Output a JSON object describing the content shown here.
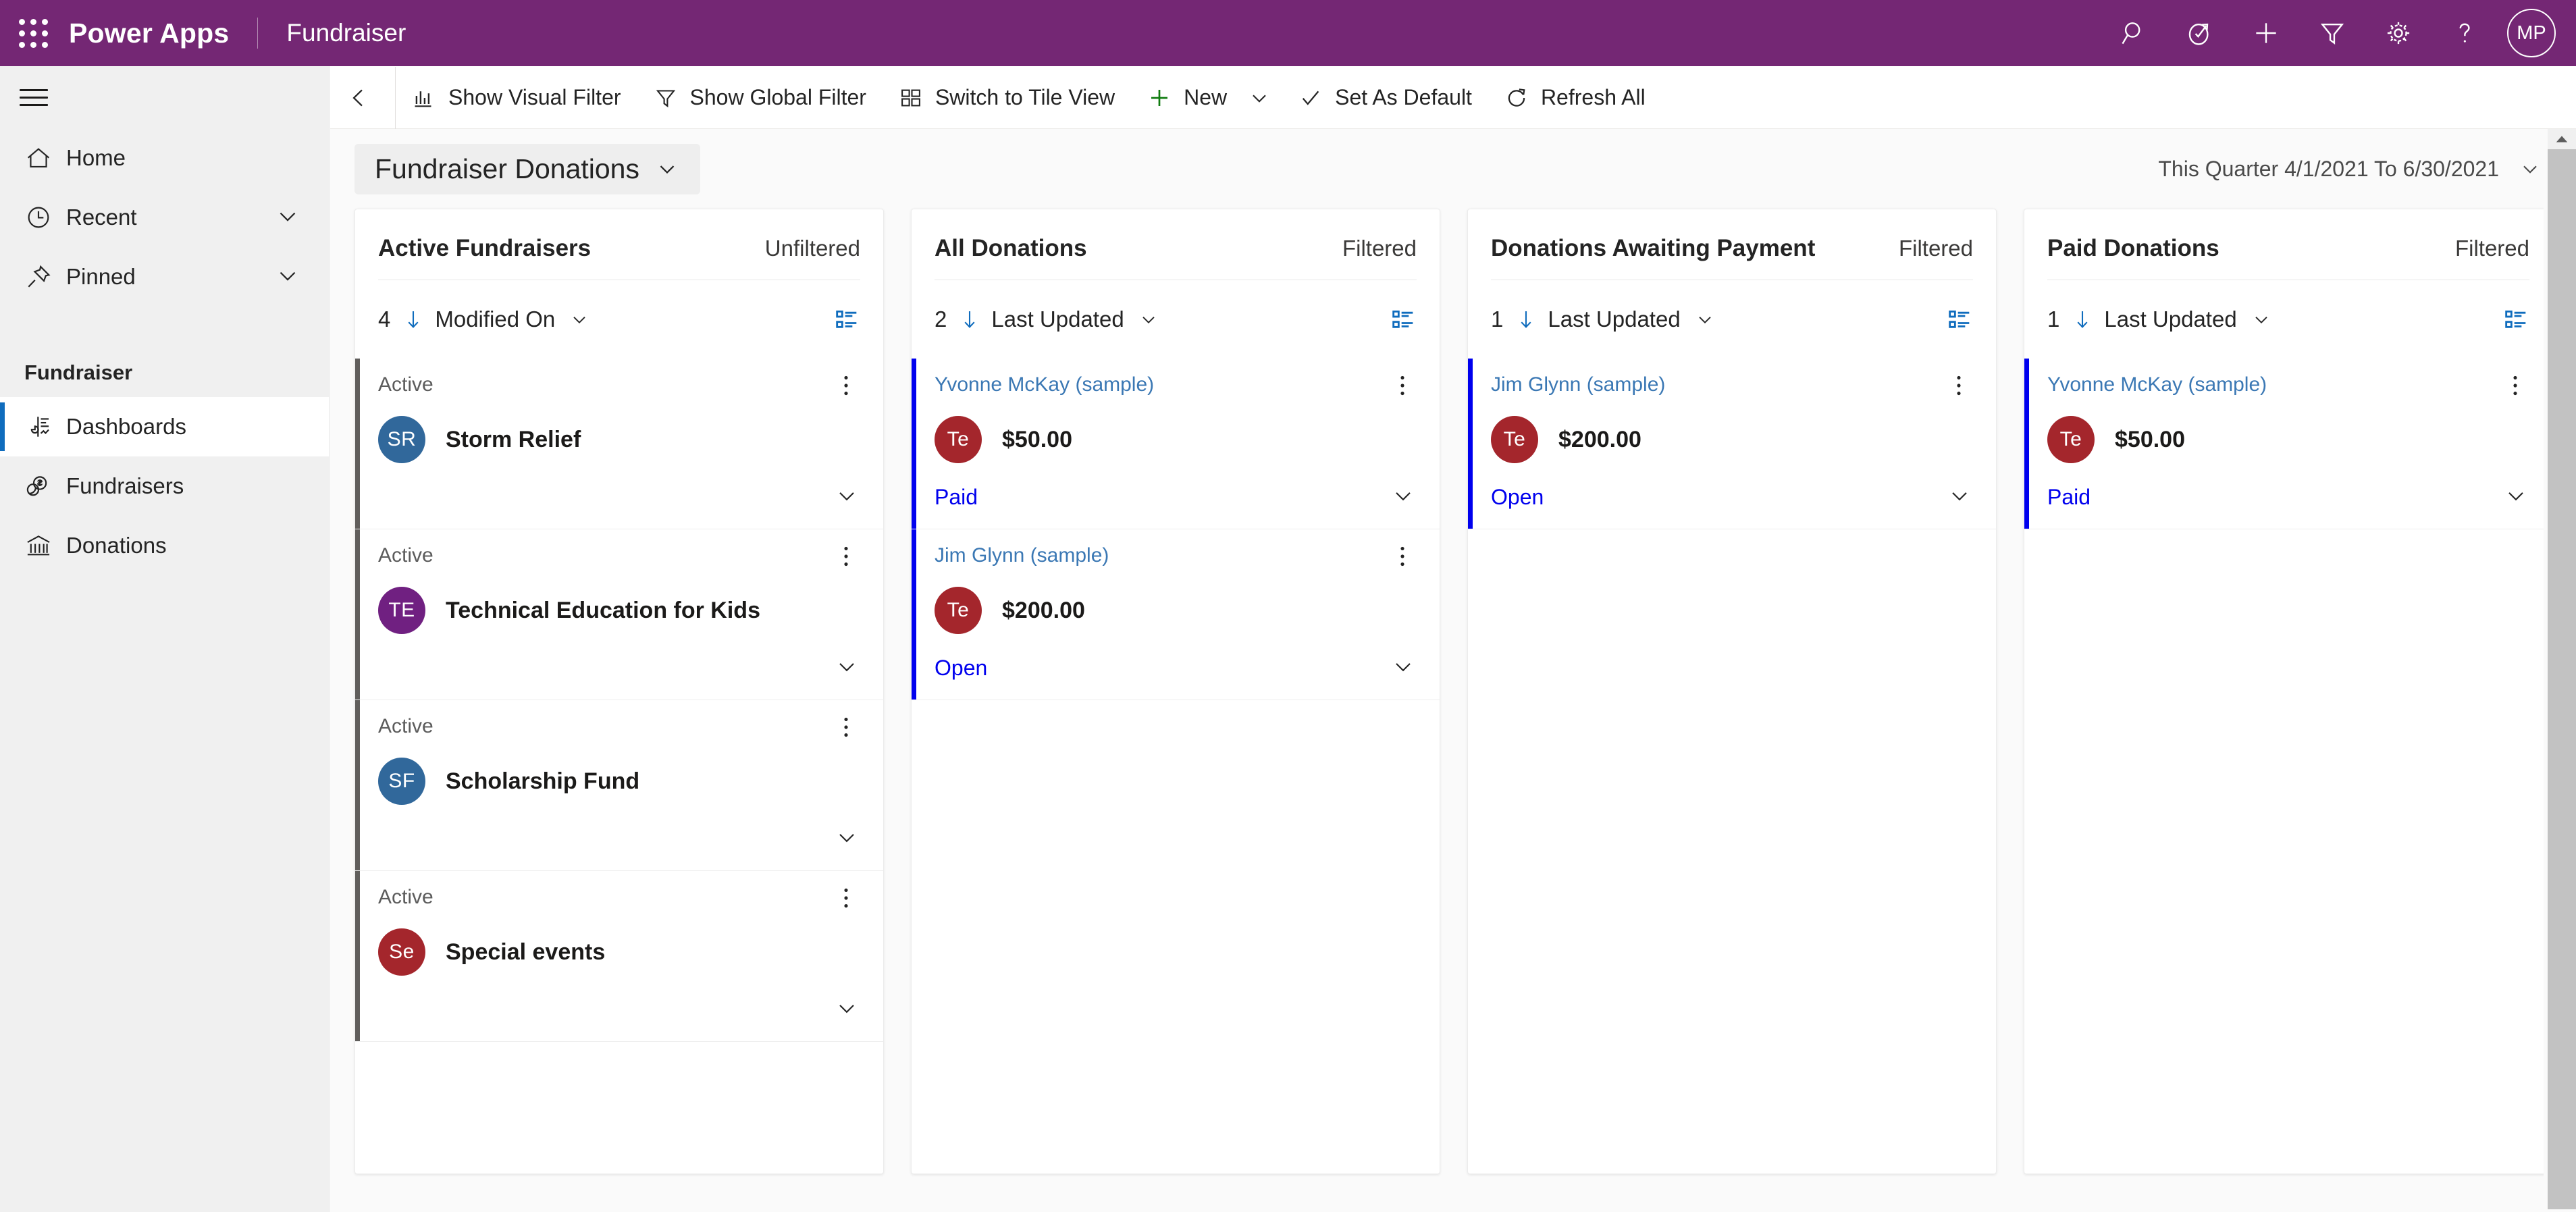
{
  "header": {
    "waffle_icon": "app-launcher-icon",
    "brand": "Power Apps",
    "app_name": "Fundraiser",
    "icons": [
      "search-icon",
      "assistant-icon",
      "new-icon",
      "filter-icon",
      "settings-icon",
      "help-icon"
    ],
    "avatar_initials": "MP",
    "bg_color": "#742774"
  },
  "sidebar": {
    "hamburger_icon": "hamburger-icon",
    "items": [
      {
        "label": "Home",
        "icon": "home-icon",
        "expandable": false,
        "selected": false
      },
      {
        "label": "Recent",
        "icon": "clock-icon",
        "expandable": true,
        "selected": false
      },
      {
        "label": "Pinned",
        "icon": "pin-icon",
        "expandable": true,
        "selected": false
      }
    ],
    "group_title": "Fundraiser",
    "group_items": [
      {
        "label": "Dashboards",
        "icon": "dashboard-icon",
        "selected": true
      },
      {
        "label": "Fundraisers",
        "icon": "coins-icon",
        "selected": false
      },
      {
        "label": "Donations",
        "icon": "bank-icon",
        "selected": false
      }
    ],
    "accent_color": "#0f6cbd"
  },
  "commandbar": {
    "back_icon": "back-arrow-icon",
    "buttons": [
      {
        "label": "Show Visual Filter",
        "icon": "bar-chart-icon",
        "caret": false
      },
      {
        "label": "Show Global Filter",
        "icon": "funnel-icon",
        "caret": false
      },
      {
        "label": "Switch to Tile View",
        "icon": "tile-view-icon",
        "caret": false
      },
      {
        "label": "New",
        "icon": "plus-icon",
        "caret": true
      },
      {
        "label": "Set As Default",
        "icon": "checkmark-icon",
        "caret": false
      },
      {
        "label": "Refresh All",
        "icon": "refresh-icon",
        "caret": false
      }
    ],
    "new_icon_color": "#107c10"
  },
  "dashboard": {
    "title": "Fundraiser Donations",
    "title_chevron": "chevron-down-icon",
    "date_range": "This Quarter 4/1/2021 To 6/30/2021",
    "date_range_chevron": "chevron-down-icon"
  },
  "columns": [
    {
      "title": "Active Fundraisers",
      "filter_state": "Unfiltered",
      "count": "4",
      "sort_field": "Modified On",
      "view_icon": "list-view-icon",
      "bar": "gray",
      "cards": [
        {
          "status": "Active",
          "status_is_link": false,
          "avatar": "SR",
          "avatar_color": "#31689b",
          "main": "Storm Relief",
          "state": ""
        },
        {
          "status": "Active",
          "status_is_link": false,
          "avatar": "TE",
          "avatar_color": "#702081",
          "main": "Technical Education for Kids",
          "state": ""
        },
        {
          "status": "Active",
          "status_is_link": false,
          "avatar": "SF",
          "avatar_color": "#31689b",
          "main": "Scholarship Fund",
          "state": ""
        },
        {
          "status": "Active",
          "status_is_link": false,
          "avatar": "Se",
          "avatar_color": "#a4262c",
          "main": "Special events",
          "state": ""
        }
      ]
    },
    {
      "title": "All Donations",
      "filter_state": "Filtered",
      "count": "2",
      "sort_field": "Last Updated",
      "view_icon": "list-view-icon",
      "bar": "blue",
      "cards": [
        {
          "status": "Yvonne McKay (sample)",
          "status_is_link": true,
          "avatar": "Te",
          "avatar_color": "#a4262c",
          "main": "$50.00",
          "state": "Paid"
        },
        {
          "status": "Jim Glynn (sample)",
          "status_is_link": true,
          "avatar": "Te",
          "avatar_color": "#a4262c",
          "main": "$200.00",
          "state": "Open"
        }
      ]
    },
    {
      "title": "Donations Awaiting Payment",
      "filter_state": "Filtered",
      "count": "1",
      "sort_field": "Last Updated",
      "view_icon": "list-view-icon",
      "bar": "blue",
      "cards": [
        {
          "status": "Jim Glynn (sample)",
          "status_is_link": true,
          "avatar": "Te",
          "avatar_color": "#a4262c",
          "main": "$200.00",
          "state": "Open"
        }
      ]
    },
    {
      "title": "Paid Donations",
      "filter_state": "Filtered",
      "count": "1",
      "sort_field": "Last Updated",
      "view_icon": "list-view-icon",
      "bar": "blue",
      "cards": [
        {
          "status": "Yvonne McKay (sample)",
          "status_is_link": true,
          "avatar": "Te",
          "avatar_color": "#a4262c",
          "main": "$50.00",
          "state": "Paid"
        }
      ]
    }
  ],
  "scrollbar": {
    "up_arrow_icon": "scroll-up-icon"
  }
}
